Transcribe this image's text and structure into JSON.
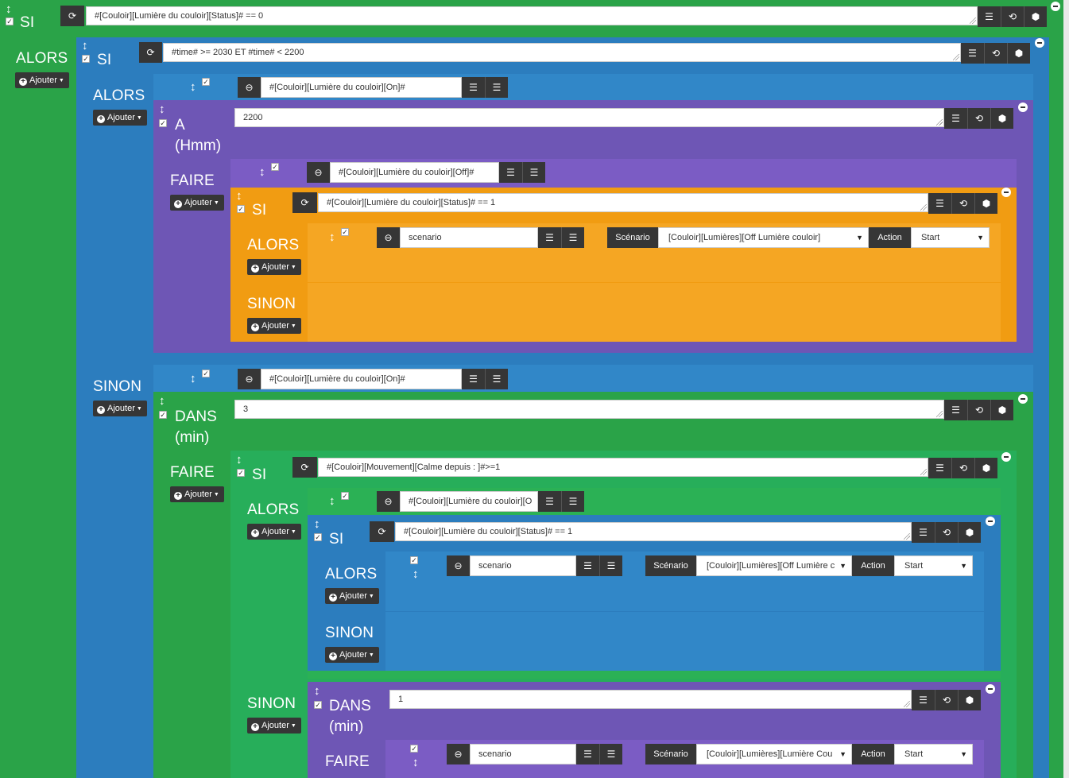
{
  "keywords": {
    "si": "SI",
    "alors": "ALORS",
    "sinon": "SINON",
    "faire": "FAIRE",
    "a": "A",
    "hmm": "(Hmm)",
    "dans": "DANS",
    "min": "(min)"
  },
  "ajouter_label": "Ajouter",
  "block1": {
    "condition": "#[Couloir][Lumière du couloir][Status]# == 0"
  },
  "block2": {
    "condition": "#time# >= 2030 ET #time# < 2200"
  },
  "action_on_1": {
    "value": "#[Couloir][Lumière du couloir][On]#"
  },
  "block_a": {
    "value": "2200"
  },
  "action_off": {
    "value": "#[Couloir][Lumière du couloir][Off]#"
  },
  "block3": {
    "condition": "#[Couloir][Lumière du couloir][Status]# == 1"
  },
  "scen1": {
    "name": "scenario",
    "scenario_label": "Scénario",
    "scenario_value": "[Couloir][Lumières][Off Lumière couloir]",
    "action_label": "Action",
    "action_value": "Start"
  },
  "action_on_2": {
    "value": "#[Couloir][Lumière du couloir][On]#"
  },
  "block_dans1": {
    "value": "3"
  },
  "block4": {
    "condition": "#[Couloir][Mouvement][Calme depuis : ]#>=1"
  },
  "action_on_3": {
    "value": "#[Couloir][Lumière du couloir][O"
  },
  "block5": {
    "condition": "#[Couloir][Lumière du couloir][Status]# == 1"
  },
  "scen2": {
    "name": "scenario",
    "scenario_label": "Scénario",
    "scenario_value": "[Couloir][Lumières][Off Lumière c",
    "action_label": "Action",
    "action_value": "Start"
  },
  "block_dans2": {
    "value": "1"
  },
  "scen3": {
    "name": "scenario",
    "scenario_label": "Scénario",
    "scenario_value": "[Couloir][Lumières][Lumière Cou",
    "action_label": "Action",
    "action_value": "Start"
  }
}
